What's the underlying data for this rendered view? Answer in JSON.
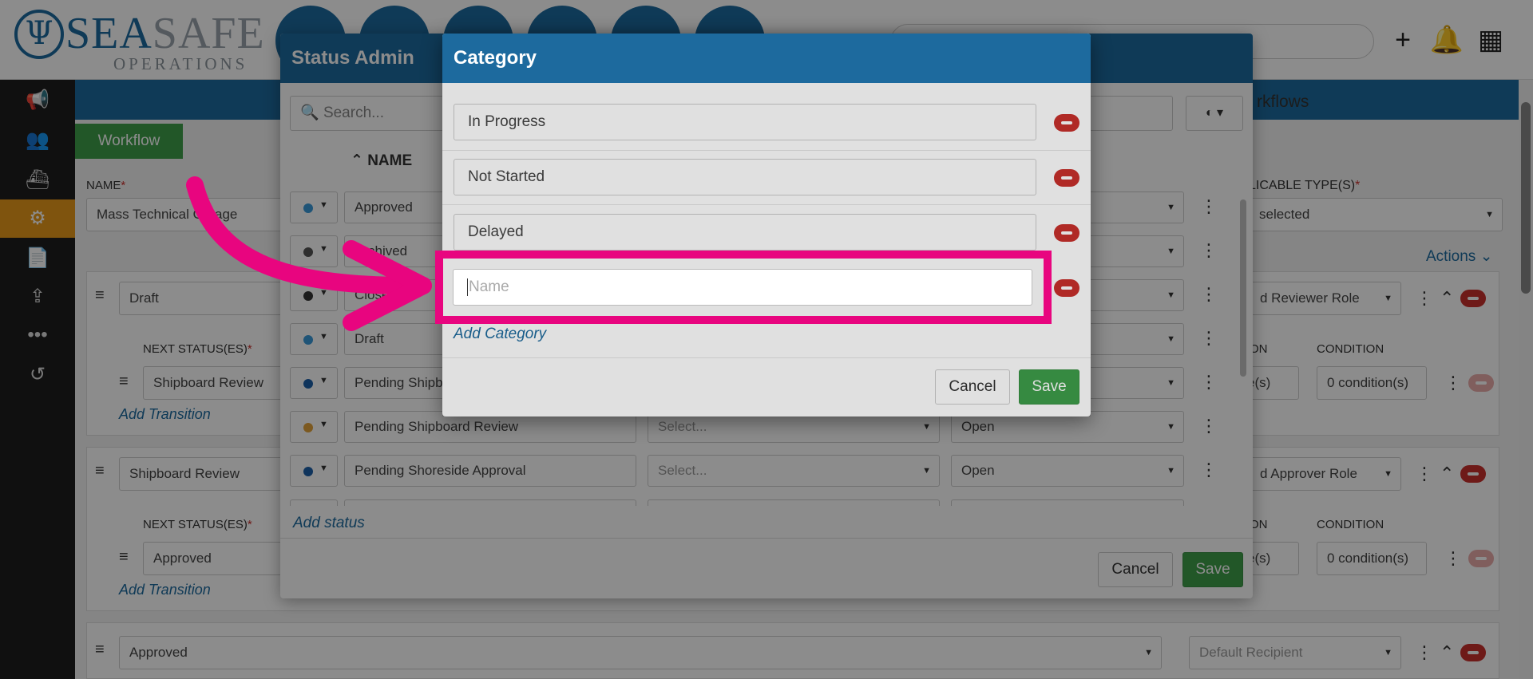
{
  "brand": {
    "name_a": "SEA",
    "name_b": "SAFE",
    "sub": "OPERATIONS"
  },
  "page": {
    "tab_workflow": "Workflow",
    "name_label": "NAME",
    "name_value": "Mass Technical Outage",
    "workflows_text": "rkflows",
    "applicable_label": "LICABLE TYPE(S)",
    "applicable_value": "selected",
    "actions_label": "Actions",
    "status_cards": [
      {
        "status": "Draft",
        "next_label": "NEXT STATUS(ES)",
        "next_value": "Shipboard Review",
        "add_transition": "Add Transition",
        "role": "d Reviewer Role",
        "col_on": "ON",
        "col_condition": "CONDITION",
        "cell_s": "e(s)",
        "cell_condition": "0 condition(s)"
      },
      {
        "status": "Shipboard Review",
        "next_label": "NEXT STATUS(ES)",
        "next_value": "Approved",
        "add_transition": "Add Transition",
        "role": "d Approver Role",
        "col_on": "ON",
        "col_condition": "CONDITION",
        "cell_s": "e(s)",
        "cell_condition": "0 condition(s)"
      },
      {
        "status": "Approved",
        "role": "Default Recipient"
      }
    ]
  },
  "status_admin": {
    "title": "Status Admin",
    "search_placeholder": "Search...",
    "column_name": "NAME",
    "rows": [
      {
        "name": "Approved",
        "color": "#3a9ad9",
        "category": "",
        "state": ""
      },
      {
        "name": "Archived",
        "color": "#555555",
        "category": "",
        "state": ""
      },
      {
        "name": "Closed",
        "color": "#333333",
        "category": "",
        "state": ""
      },
      {
        "name": "Draft",
        "color": "#3a9ad9",
        "category": "",
        "state": ""
      },
      {
        "name": "Pending Shipb",
        "color": "#1d5fa8",
        "category": "",
        "state": ""
      },
      {
        "name": "Pending Shipboard Review",
        "color": "#e2a23b",
        "category": "Select...",
        "state": "Open"
      },
      {
        "name": "Pending Shoreside Approval",
        "color": "#1d5fa8",
        "category": "Select...",
        "state": "Open"
      }
    ],
    "add_status": "Add status",
    "cancel": "Cancel",
    "save": "Save"
  },
  "category_modal": {
    "title": "Category",
    "items": [
      "In Progress",
      "Not Started",
      "Delayed"
    ],
    "new_placeholder": "Name",
    "add_category": "Add Category",
    "cancel": "Cancel",
    "save": "Save"
  },
  "colors": {
    "brand_blue": "#1d6a9e",
    "accent_orange": "#e89a1a",
    "save_green": "#3e9e4a",
    "danger_red": "#c9302c",
    "highlight_pink": "#e8057f"
  }
}
